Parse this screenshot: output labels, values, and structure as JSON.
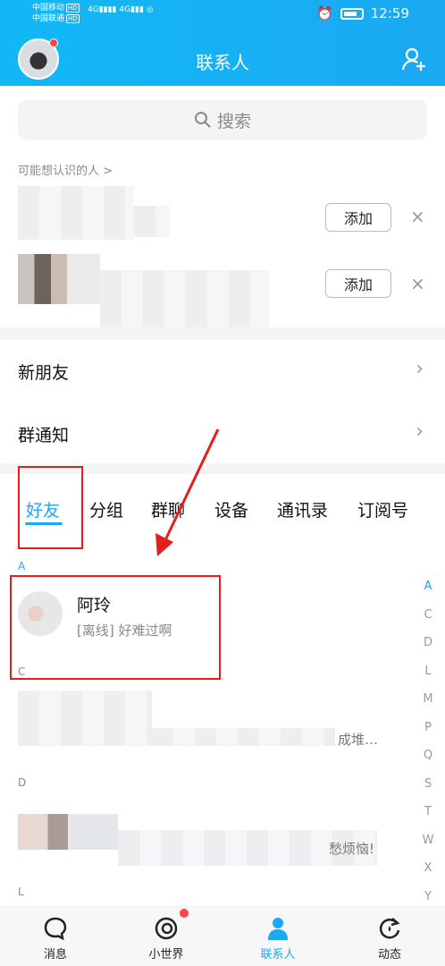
{
  "status_bar": {
    "carrier1": "中国移动",
    "carrier2": "中国联通",
    "hd": "HD",
    "net1": "4G",
    "net2": "4G",
    "time": "12:59"
  },
  "header": {
    "title": "联系人"
  },
  "search": {
    "placeholder": "搜索"
  },
  "may_know": {
    "label": "可能想认识的人 >",
    "add_label": "添加",
    "close": "×"
  },
  "menu": {
    "new_friends": "新朋友",
    "group_notice": "群通知",
    "chevron": "›"
  },
  "tabs": [
    "好友",
    "分组",
    "群聊",
    "设备",
    "通讯录",
    "订阅号"
  ],
  "sections": {
    "a": "A",
    "c": "C",
    "d": "D",
    "l": "L"
  },
  "friend": {
    "name": "阿玲",
    "status": "[离线] 好难过啊"
  },
  "blurred": {
    "c_tail": "成堆…",
    "d_tail": "愁烦恼!"
  },
  "index_letters": [
    "A",
    "C",
    "D",
    "L",
    "M",
    "P",
    "Q",
    "S",
    "T",
    "W",
    "X",
    "Y"
  ],
  "bottom_nav": [
    "消息",
    "小世界",
    "联系人",
    "动态"
  ],
  "colors": {
    "accent": "#1aa9f3",
    "annotation": "#e51d1d"
  }
}
